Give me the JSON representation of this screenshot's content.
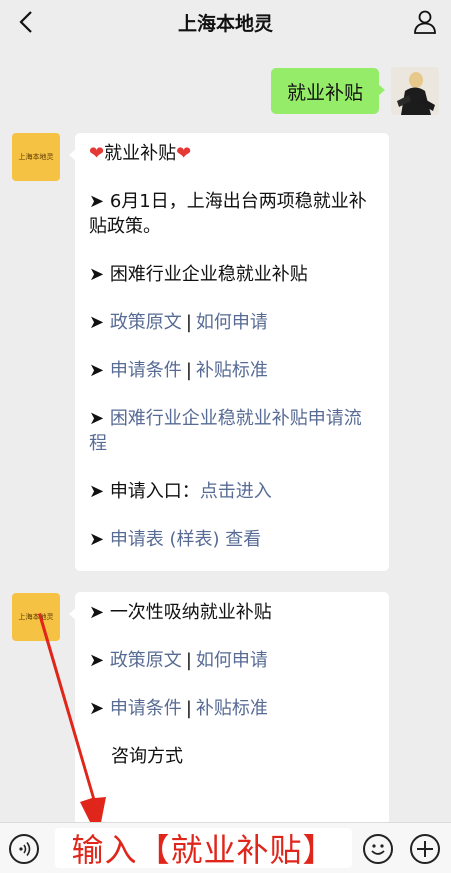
{
  "header": {
    "title": "上海本地灵"
  },
  "user_message": "就业补贴",
  "account": {
    "avatar_text": "上海本地灵"
  },
  "card1": {
    "title": "就业补贴",
    "l1_prefix": "➤ ",
    "l1_text": "6月1日，上海出台两项稳就业补贴政策。",
    "l2_prefix": "➤ ",
    "l2_text": "困难行业企业稳就业补贴",
    "l3_prefix": "➤ ",
    "l3_link_a": "政策原文",
    "l3_sep": "|",
    "l3_link_b": "如何申请",
    "l4_prefix": "➤ ",
    "l4_link_a": "申请条件",
    "l4_sep": "|",
    "l4_link_b": "补贴标准",
    "l5_prefix": "➤ ",
    "l5_link": "困难行业企业稳就业补贴申请流程",
    "l6_prefix": "➤ ",
    "l6_text": "申请入口：",
    "l6_link": "点击进入",
    "l7_prefix": "➤ ",
    "l7_link": "申请表 (样表) 查看"
  },
  "card2": {
    "l1_prefix": "➤ ",
    "l1_text": "一次性吸纳就业补贴",
    "l2_prefix": "➤ ",
    "l2_link_a": "政策原文",
    "l2_sep": "|",
    "l2_link_b": "如何申请",
    "l3_prefix": "➤ ",
    "l3_link_a": "申请条件",
    "l3_sep": "|",
    "l3_link_b": "补贴标准",
    "l4_text": "咨询方式"
  },
  "input": {
    "value": "输入【就业补贴】"
  },
  "colors": {
    "link": "#576b95",
    "bubble_me": "#95ec69",
    "overlay": "#e0261b",
    "avatar": "#f6c244"
  }
}
